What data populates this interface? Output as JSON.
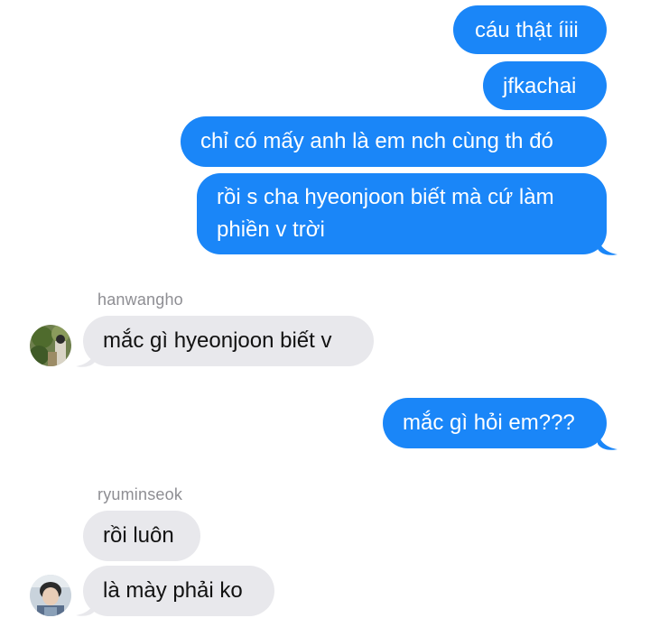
{
  "thread": {
    "outgoing_1": "cáu thật íiii",
    "outgoing_2": "jfkachai",
    "outgoing_3": "chỉ có mấy anh là em nch cùng th đó",
    "outgoing_4_line1": "rồi s cha hyeonjoon biết mà cứ làm",
    "outgoing_4_line2": "phiền v trời",
    "sender_1": "hanwangho",
    "incoming_1": "mắc gì hyeonjoon biết v",
    "outgoing_5": "mắc gì hỏi em???",
    "sender_2": "ryuminseok",
    "incoming_2": "rồi luôn",
    "incoming_3": "là mày phải ko"
  },
  "colors": {
    "outgoing_bubble": "#1a86f8",
    "incoming_bubble": "#e8e8ec",
    "sender_name": "#8e8e93"
  }
}
